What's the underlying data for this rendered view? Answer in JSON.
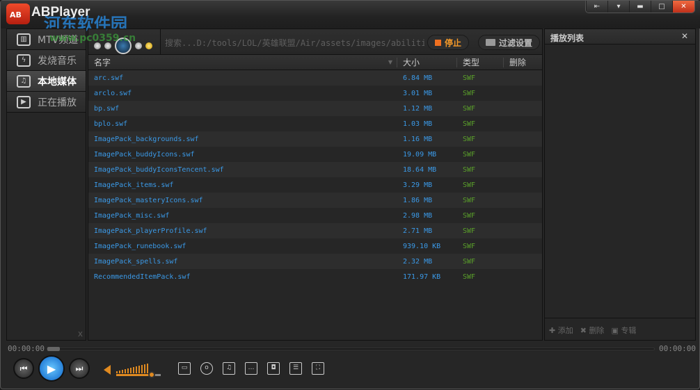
{
  "app": {
    "title": "ABPlayer",
    "logo_text": "AB",
    "watermark": "河东软件园",
    "watermark_url": "www.pc0359.cn"
  },
  "window_buttons": [
    {
      "name": "mini-mode-button",
      "icon": "⇤"
    },
    {
      "name": "menu-button",
      "icon": "▾"
    },
    {
      "name": "minimize-button",
      "icon": "▬"
    },
    {
      "name": "maximize-button",
      "icon": "□"
    },
    {
      "name": "close-button",
      "icon": "✕"
    }
  ],
  "sidebar": {
    "items": [
      {
        "label": "MTV频道",
        "icon": "mtv-icon",
        "glyph": "▥",
        "active": false
      },
      {
        "label": "发烧音乐",
        "icon": "lightning-icon",
        "glyph": "ϟ",
        "active": false
      },
      {
        "label": "本地媒体",
        "icon": "local-media-icon",
        "glyph": "♫",
        "active": true
      },
      {
        "label": "正在播放",
        "icon": "play-icon",
        "glyph": "▶",
        "active": false
      }
    ],
    "close": "x"
  },
  "toolbar": {
    "search_text": "搜索...D:/tools/LOL/英雄联盟/Air/assets/images/abilities",
    "stop_label": "停止",
    "filter_label": "过滤设置"
  },
  "table": {
    "columns": [
      "名字",
      "大小",
      "类型",
      "删除"
    ],
    "rows": [
      {
        "name": "arc.swf",
        "size": "6.84 MB",
        "type": "SWF"
      },
      {
        "name": "arclo.swf",
        "size": "3.01 MB",
        "type": "SWF"
      },
      {
        "name": "bp.swf",
        "size": "1.12 MB",
        "type": "SWF"
      },
      {
        "name": "bplo.swf",
        "size": "1.03 MB",
        "type": "SWF"
      },
      {
        "name": "ImagePack_backgrounds.swf",
        "size": "1.16 MB",
        "type": "SWF"
      },
      {
        "name": "ImagePack_buddyIcons.swf",
        "size": "19.09 MB",
        "type": "SWF"
      },
      {
        "name": "ImagePack_buddyIconsTencent.swf",
        "size": "18.64 MB",
        "type": "SWF"
      },
      {
        "name": "ImagePack_items.swf",
        "size": "3.29 MB",
        "type": "SWF"
      },
      {
        "name": "ImagePack_masteryIcons.swf",
        "size": "1.86 MB",
        "type": "SWF"
      },
      {
        "name": "ImagePack_misc.swf",
        "size": "2.98 MB",
        "type": "SWF"
      },
      {
        "name": "ImagePack_playerProfile.swf",
        "size": "2.71 MB",
        "type": "SWF"
      },
      {
        "name": "ImagePack_runebook.swf",
        "size": "939.10 KB",
        "type": "SWF"
      },
      {
        "name": "ImagePack_spells.swf",
        "size": "2.32 MB",
        "type": "SWF"
      },
      {
        "name": "RecommendedItemPack.swf",
        "size": "171.97 KB",
        "type": "SWF"
      }
    ]
  },
  "playlist": {
    "title": "播放列表",
    "close": "✕",
    "add": "添加",
    "delete": "删除",
    "album": "专辑"
  },
  "player": {
    "current_time": "00:00:00",
    "total_time": "00:00:00",
    "progress": 0,
    "volume_percent": 80
  },
  "colors": {
    "accent": "#f07020",
    "link": "#3b9ae8",
    "type": "#5aa02a",
    "play": "#0a62c8"
  }
}
